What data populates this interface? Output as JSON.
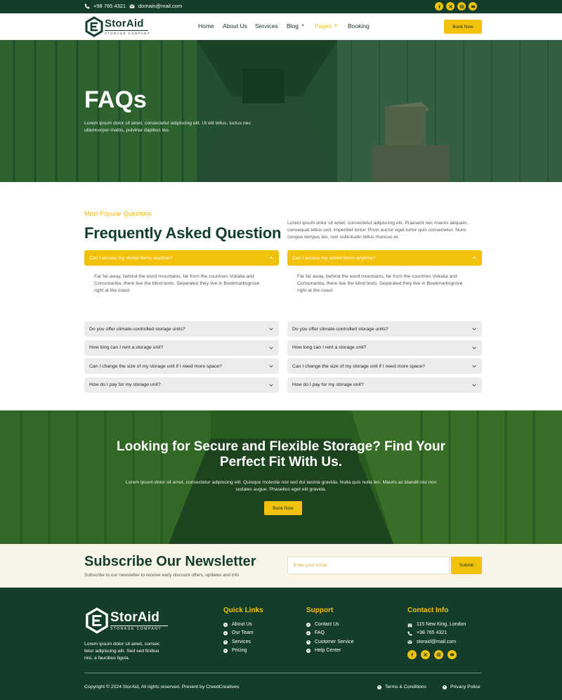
{
  "topbar": {
    "phone": "+98 765 4321",
    "email": "domain@mail.com",
    "social_icons": [
      "facebook-icon",
      "x-icon",
      "instagram-icon",
      "youtube-icon"
    ]
  },
  "brand": {
    "name": "StorAid",
    "tagline": "Storage Company",
    "accent": "#f2c10c",
    "dark": "#153d2c"
  },
  "nav": {
    "items": [
      {
        "label": "Home"
      },
      {
        "label": "About Us"
      },
      {
        "label": "Services"
      },
      {
        "label": "Blog"
      },
      {
        "label": "Pages"
      },
      {
        "label": "Booking"
      }
    ],
    "cta": "Book Now"
  },
  "hero": {
    "title": "FAQs",
    "text": "Lorem ipsum dolor sit amet, consectetur adipiscing elit. Ut elit tellus, luctus nec ullamcorper mattis, pulvinar dapibus leo."
  },
  "faq": {
    "eyebrow": "Most Popular Questions",
    "title": "Frequently Asked Question",
    "intro": "Lorem ipsum dolor sit amet, consectetur adipiscing elit. Praesent nec mauris aliquam, consequat tellus sed, imperdiet tortor. Proin auctor eget tortor quis consectetur. Nunc congue tempus leo, non sollicitudin tellus rhoncus et.",
    "columns": [
      {
        "open_question": "Can I access my stored items anytime?",
        "open_answer": "Far far away, behind the word mountains, far from the countries Vokalia and Consonantia, there live the blind texts. Separated they live in Bookmarksgrove right at the coast",
        "questions": [
          "Do you offer climate-controlled storage units?",
          "How long can I rent a storage unit?",
          "Can I change the size of my storage unit if I need more space?",
          "How do I pay for my storage unit?"
        ]
      },
      {
        "open_question": "Can I access my stored items anytime?",
        "open_answer": "Far far away, behind the word mountains, far from the countries Vokalia and Consonantia, there live the blind texts. Separated they live in Bookmarksgrove right at the coast",
        "questions": [
          "Do you offer climate-controlled storage units?",
          "How long can I rent a storage unit?",
          "Can I change the size of my storage unit if I need more space?",
          "How do I pay for my storage unit?"
        ]
      }
    ]
  },
  "cta": {
    "title": "Looking for Secure and Flexible Storage? Find Your Perfect Fit With Us.",
    "text": "Lorem ipsum dolor sit amet, consectetur adipiscing elit. Quisque molestie nisl sed dui lacinia gravida. Nulla quis nulla leo. Mauris ac blandit nisi non sodales augue. Phasellus eget elit gravida.",
    "button": "Book Now"
  },
  "newsletter": {
    "title": "Subscribe Our Newsletter",
    "subtitle": "Subscribe to our newsletter to receive early discount offers, updates and info",
    "placeholder": "Enter your email",
    "button": "Submit"
  },
  "footer": {
    "description": "Lorem ipsum dolor sit amet, consec tetur adipiscing elit. Sed sed finibus nisi, a faucibus ligula.",
    "quick_links": {
      "title": "Quick Links",
      "items": [
        "About Us",
        "Our Team",
        "Services",
        "Pricing"
      ]
    },
    "support": {
      "title": "Support",
      "items": [
        "Contact Us",
        "FAQ",
        "Customer Service",
        "Help Center"
      ]
    },
    "contact": {
      "title": "Contact Info",
      "address": "115 New King, London",
      "phone": "+98 765 4321",
      "email": "storaid@mail.com"
    },
    "copyright": "Copyright © 2024 StorAid, All rights reserved. Present by CreedCreatives",
    "legal": [
      "Terms & Conditions",
      "Privacy Police"
    ]
  }
}
